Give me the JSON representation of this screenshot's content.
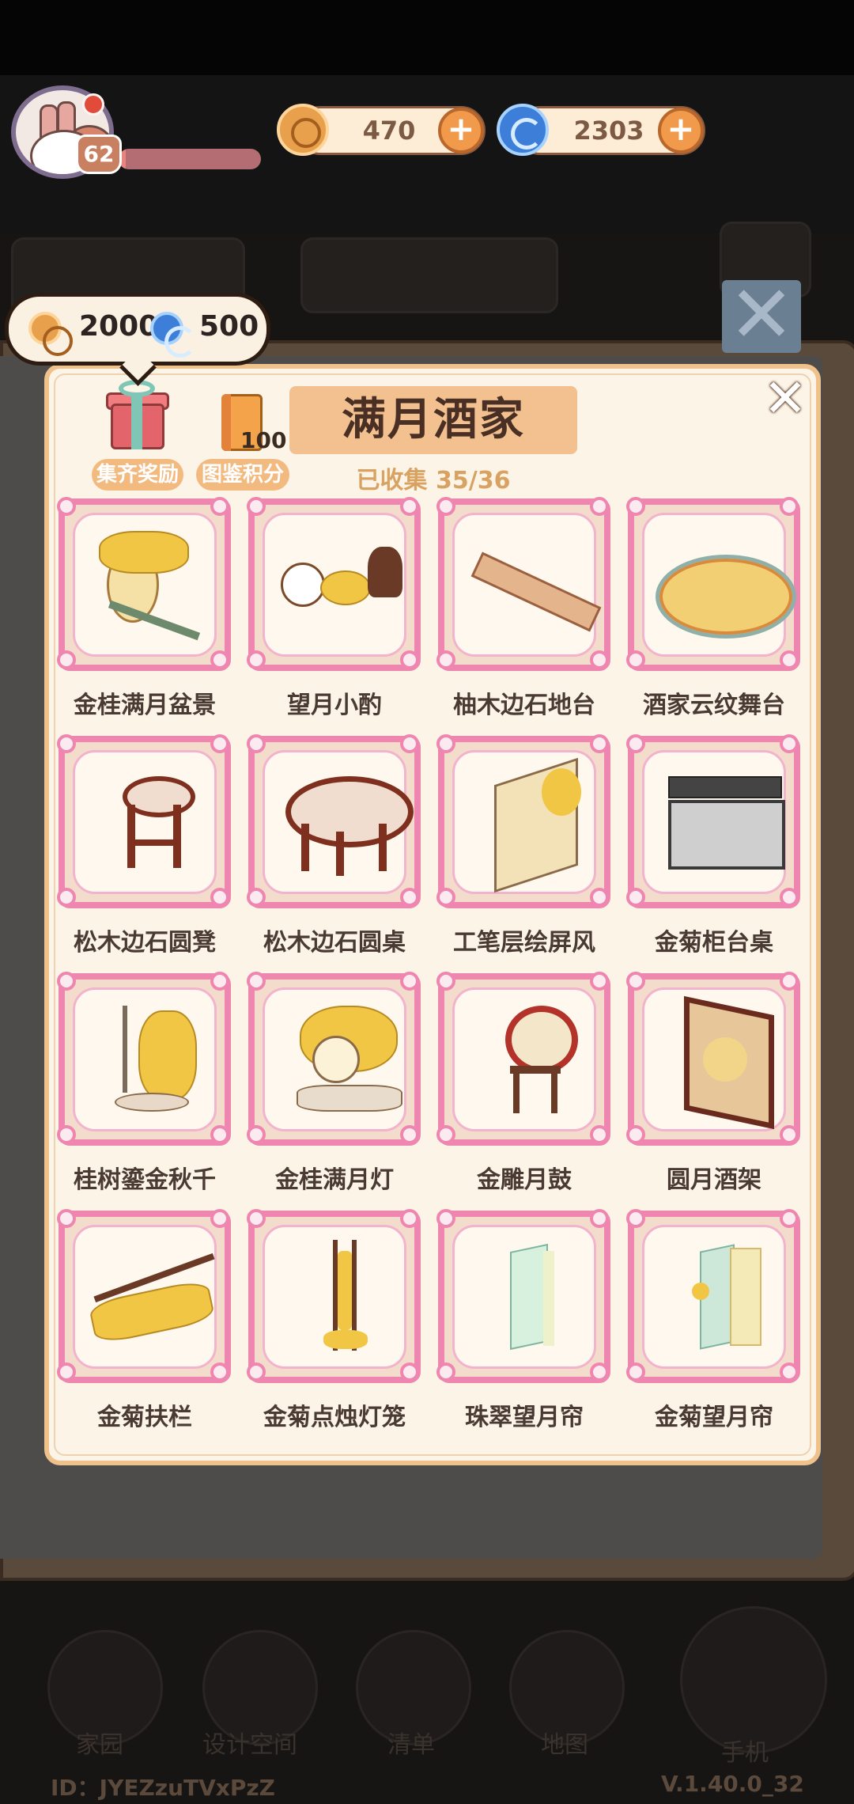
{
  "hud": {
    "level": "62",
    "xp_fraction": 0.05,
    "coins": "470",
    "gems": "2303"
  },
  "tooltip": {
    "coin_reward": "2000",
    "gem_reward": "500"
  },
  "panel": {
    "title": "满月酒家",
    "collected": "已收集 35/36",
    "reward_label": "集齐奖励",
    "score_label": "图鉴积分",
    "score_value": "100"
  },
  "items": [
    {
      "name": "金桂满月盆景",
      "icon": "osmanthus-bonsai-icon"
    },
    {
      "name": "望月小酌",
      "icon": "wine-set-icon"
    },
    {
      "name": "柚木边石地台",
      "icon": "teak-platform-icon"
    },
    {
      "name": "酒家云纹舞台",
      "icon": "cloud-stage-icon"
    },
    {
      "name": "松木边石圆凳",
      "icon": "round-stool-icon"
    },
    {
      "name": "松木边石圆桌",
      "icon": "round-table-icon"
    },
    {
      "name": "工笔层绘屏风",
      "icon": "painted-screen-icon"
    },
    {
      "name": "金菊柜台桌",
      "icon": "chrysanthemum-counter-icon"
    },
    {
      "name": "桂树鎏金秋千",
      "icon": "gilded-swing-icon"
    },
    {
      "name": "金桂满月灯",
      "icon": "moon-lamp-icon"
    },
    {
      "name": "金雕月鼓",
      "icon": "moon-drum-icon"
    },
    {
      "name": "圆月酒架",
      "icon": "wine-rack-icon"
    },
    {
      "name": "金菊扶栏",
      "icon": "chrysanthemum-railing-icon"
    },
    {
      "name": "金菊点烛灯笼",
      "icon": "candle-lantern-icon"
    },
    {
      "name": "珠翠望月帘",
      "icon": "jade-curtain-icon"
    },
    {
      "name": "金菊望月帘",
      "icon": "chrysanthemum-curtain-icon"
    }
  ],
  "footer": {
    "nav": [
      "家园",
      "设计空间",
      "清单",
      "地图",
      "手机"
    ],
    "user_id": "ID：JYEZzuTVxPzZ",
    "version": "V.1.40.0_32"
  },
  "colors": {
    "card_border": "#ee86b0",
    "panel_bg": "#fcf4e6",
    "title_banner": "#f3c190"
  }
}
